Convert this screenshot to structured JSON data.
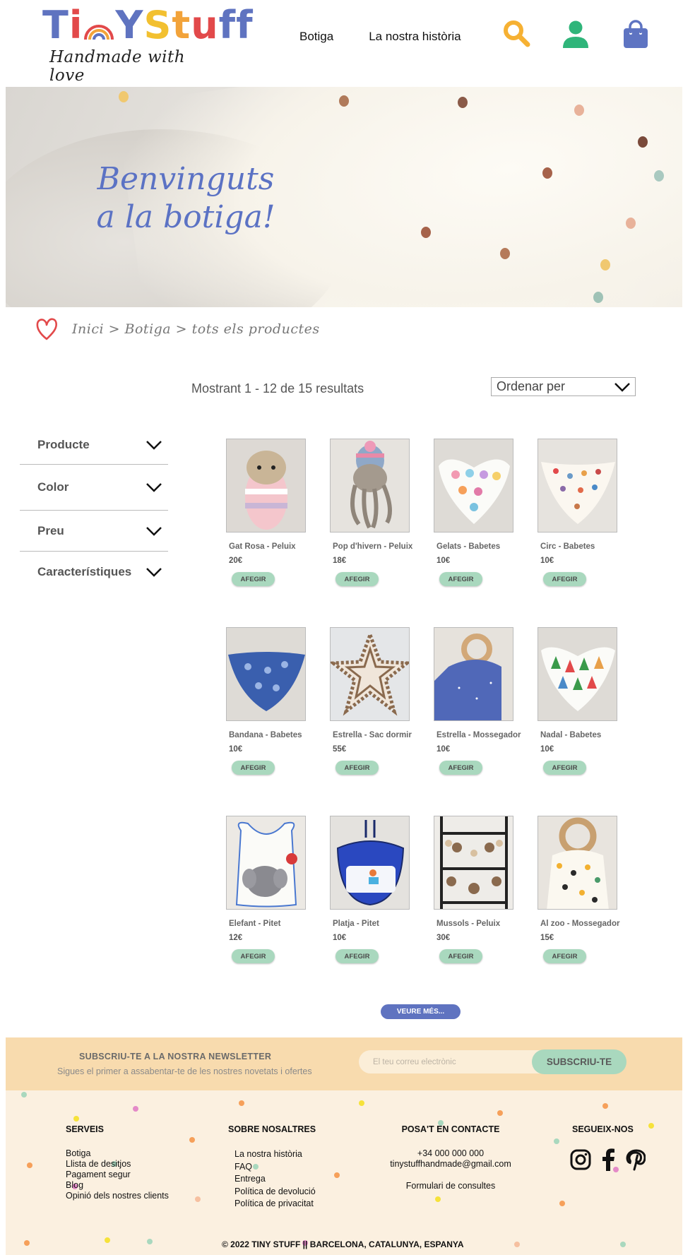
{
  "header": {
    "logo": {
      "title_letters": [
        "T",
        "i",
        "n",
        "Y",
        " ",
        "S",
        "t",
        "u",
        "f",
        "f"
      ],
      "subtitle": "Handmade with love"
    },
    "nav": [
      {
        "label": "Botiga"
      },
      {
        "label": "La nostra història"
      }
    ],
    "icons": {
      "search": "search-icon",
      "account": "user-icon",
      "cart": "shopping-bag-icon"
    }
  },
  "hero": {
    "line1": "Benvinguts",
    "line2": "a la botiga!"
  },
  "breadcrumb": {
    "text": "Inici > Botiga > tots els productes"
  },
  "results": {
    "text": "Mostrant 1 - 12 de 15 resultats",
    "sort_label": "Ordenar per"
  },
  "filters": [
    {
      "label": "Producte"
    },
    {
      "label": "Color"
    },
    {
      "label": "Preu"
    },
    {
      "label": "Característiques"
    }
  ],
  "products": [
    {
      "name": "Gat Rosa - Peluix",
      "price": "20€",
      "button": "AFEGIR"
    },
    {
      "name": "Pop d'hivern - Peluix",
      "price": "18€",
      "button": "AFEGIR"
    },
    {
      "name": "Gelats - Babetes",
      "price": "10€",
      "button": "AFEGIR"
    },
    {
      "name": "Circ - Babetes",
      "price": "10€",
      "button": "AFEGIR"
    },
    {
      "name": "Bandana - Babetes",
      "price": "10€",
      "button": "AFEGIR"
    },
    {
      "name": "Estrella - Sac dormir",
      "price": "55€",
      "button": "AFEGIR"
    },
    {
      "name": "Estrella - Mossegador",
      "price": "10€",
      "button": "AFEGIR"
    },
    {
      "name": "Nadal - Babetes",
      "price": "10€",
      "button": "AFEGIR"
    },
    {
      "name": "Elefant - Pitet",
      "price": "12€",
      "button": "AFEGIR"
    },
    {
      "name": "Platja - Pitet",
      "price": "10€",
      "button": "AFEGIR"
    },
    {
      "name": "Mussols - Peluix",
      "price": "30€",
      "button": "AFEGIR"
    },
    {
      "name": "Al zoo - Mossegador",
      "price": "15€",
      "button": "AFEGIR"
    }
  ],
  "more_button": "VEURE MÉS...",
  "newsletter": {
    "title": "SUBSCRIU-TE A LA NOSTRA NEWSLETTER",
    "subtitle": "Sigues el primer a assabentar-te de les nostres novetats i ofertes",
    "placeholder": "El teu correu electrònic",
    "button": "SUBSCRIU-TE"
  },
  "footer": {
    "serveis": {
      "heading": "SERVEIS",
      "items": [
        "Botiga",
        "Llista de desitjos",
        "Pagament segur",
        "Blog",
        "Opinió dels nostres clients"
      ]
    },
    "sobre": {
      "heading": "SOBRE NOSALTRES",
      "items": [
        "La nostra història",
        "FAQ",
        "Entrega",
        "Política de devolució",
        "Política de privacitat"
      ]
    },
    "contacte": {
      "heading": "POSA'T EN CONTACTE",
      "phone": "+34 000 000 000",
      "email": "tinystuffhandmade@gmail.com",
      "form": "Formulari de consultes"
    },
    "segueix": {
      "heading": "SEGUEIX-NOS",
      "icons": [
        "instagram-icon",
        "facebook-icon",
        "pinterest-icon"
      ]
    },
    "copyright": "© 2022 TINY STUFF || BARCELONA, CATALUNYA, ESPANYA"
  },
  "colors": {
    "brand_blue": "#5f73c0",
    "mint": "#a9d8be",
    "search_yellow": "#f6b133",
    "account_green": "#2fb57a",
    "cart_blue": "#5e74c2",
    "newsletter_bg": "#f8dbae",
    "footer_bg": "#fbf0e0"
  }
}
